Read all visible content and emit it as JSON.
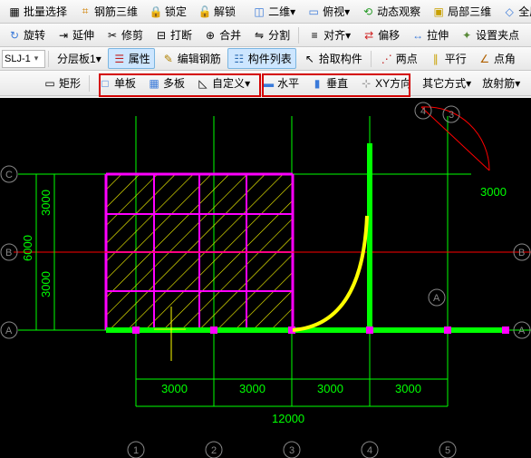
{
  "row1": {
    "batch_select": "批量选择",
    "rebar3d": "钢筋三维",
    "lock": "锁定",
    "unlock": "解锁",
    "two_d": "二维",
    "pan_view": "俯视",
    "dyn_obs": "动态观察",
    "local3d": "局部三维",
    "full": "全屏"
  },
  "row2": {
    "rotate": "旋转",
    "extend": "延伸",
    "trim": "修剪",
    "break": "打断",
    "merge": "合并",
    "split": "分割",
    "align": "对齐",
    "offset": "偏移",
    "stretch": "拉伸",
    "set_grip": "设置夹点"
  },
  "row3": {
    "layer_combo": "SLJ-1",
    "slab_combo": "分层板1",
    "attr": "属性",
    "edit_rebar": "编辑钢筋",
    "comp_list": "构件列表",
    "pick_comp": "拾取构件",
    "two_pt": "两点",
    "parallel": "平行",
    "pt_angle": "点角"
  },
  "row4": {
    "rect": "矩形",
    "single": "单板",
    "multi": "多板",
    "custom": "自定义",
    "horiz": "水平",
    "vert": "垂直",
    "xy": "XY方向",
    "other": "其它方式",
    "radial": "放射筋"
  },
  "dims": {
    "d3000": "3000",
    "d6000": "6000",
    "d12000": "12000"
  },
  "grid_labels": {
    "A": "A",
    "B": "B",
    "C": "C",
    "n1": "1",
    "n2": "2",
    "n3": "3",
    "n4": "4",
    "n5": "5"
  }
}
